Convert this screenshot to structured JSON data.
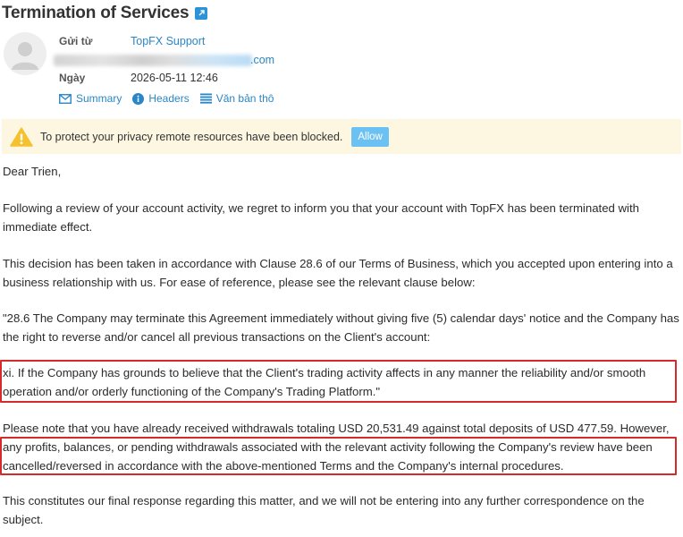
{
  "email": {
    "subject": "Termination of Services",
    "from_label": "Gửi từ",
    "from_name": "TopFX Support",
    "address_suffix": ".com",
    "date_label": "Ngày",
    "date_value": "2026-05-11 12:46",
    "view_tabs": [
      {
        "label": "Summary",
        "icon": "envelope-icon"
      },
      {
        "label": "Headers",
        "icon": "info-icon"
      },
      {
        "label": "Văn bản thô",
        "icon": "lines-icon"
      }
    ]
  },
  "notice": {
    "text": "To protect your privacy remote resources have been blocked.",
    "button_label": "Allow",
    "icon": "warning-icon"
  },
  "body": {
    "greeting": "Dear Trien,",
    "p1": "Following a review of your account activity, we regret to inform you that your account with TopFX has been terminated with immediate effect.",
    "p2": "This decision has been taken in accordance with Clause 28.6 of our Terms of Business, which you accepted upon entering into a business relationship with us. For ease of reference, please see the relevant clause below:",
    "p3": "\"28.6 The Company may terminate this Agreement immediately without giving five (5) calendar days' notice and the Company has the right to reverse and/or cancel all previous transactions on the Client's account:",
    "p4": "xi. If the Company has grounds to believe that the Client's trading activity affects in any manner the reliability and/or smooth operation and/or orderly functioning of the Company's Trading Platform.\"",
    "p5_line1": "Please note that you have already received withdrawals totaling USD 20,531.49 against total deposits of USD 477.59. However,",
    "p5_rest": "any profits, balances, or pending withdrawals associated with the relevant activity following the Company's review have been cancelled/reversed in accordance with the above-mentioned Terms and the Company's internal procedures.",
    "p6": "This constitutes our final response regarding this matter, and we will not be entering into any further correspondence on the subject."
  },
  "colors": {
    "link": "#2a86c6",
    "notice_bg": "#fdf6e1",
    "allow_button": "#6bc2f2",
    "highlight": "#d42a2a"
  }
}
